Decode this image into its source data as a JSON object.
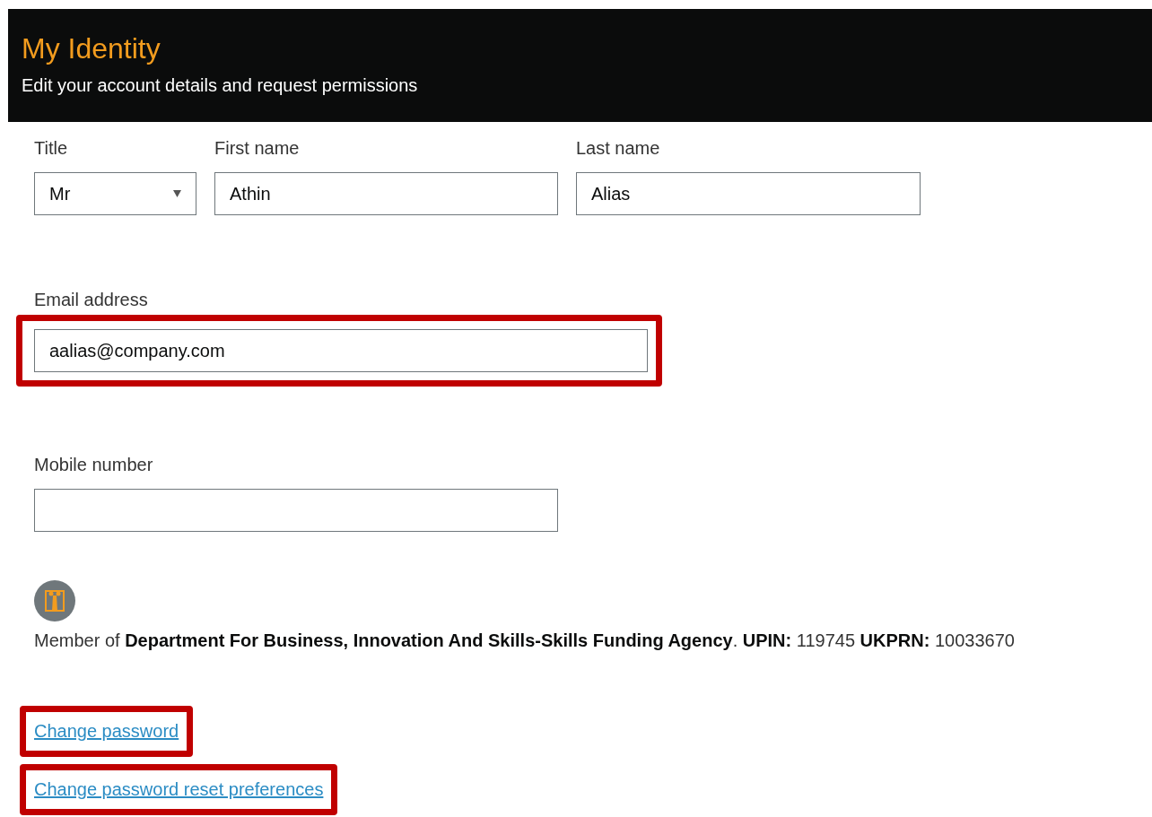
{
  "header": {
    "title": "My Identity",
    "subtitle": "Edit your account details and request permissions"
  },
  "name_fields": [
    {
      "kind": "select",
      "label": "Title",
      "value": "Mr"
    },
    {
      "kind": "text",
      "label": "First name",
      "value": "Athin"
    },
    {
      "kind": "text",
      "label": "Last name",
      "value": "Alias"
    }
  ],
  "email": {
    "label": "Email address",
    "value": "aalias@company.com",
    "highlighted": true
  },
  "mobile": {
    "label": "Mobile number"
  },
  "membership": "Member of **Department For Business, Innovation And Skills-Skills Funding Agency**. **UPIN:** 119745 **UKPRN:** 10033670",
  "links": [
    {
      "label": "Change password",
      "highlighted": true
    },
    {
      "label": "Change password reset preferences",
      "highlighted": true
    }
  ]
}
